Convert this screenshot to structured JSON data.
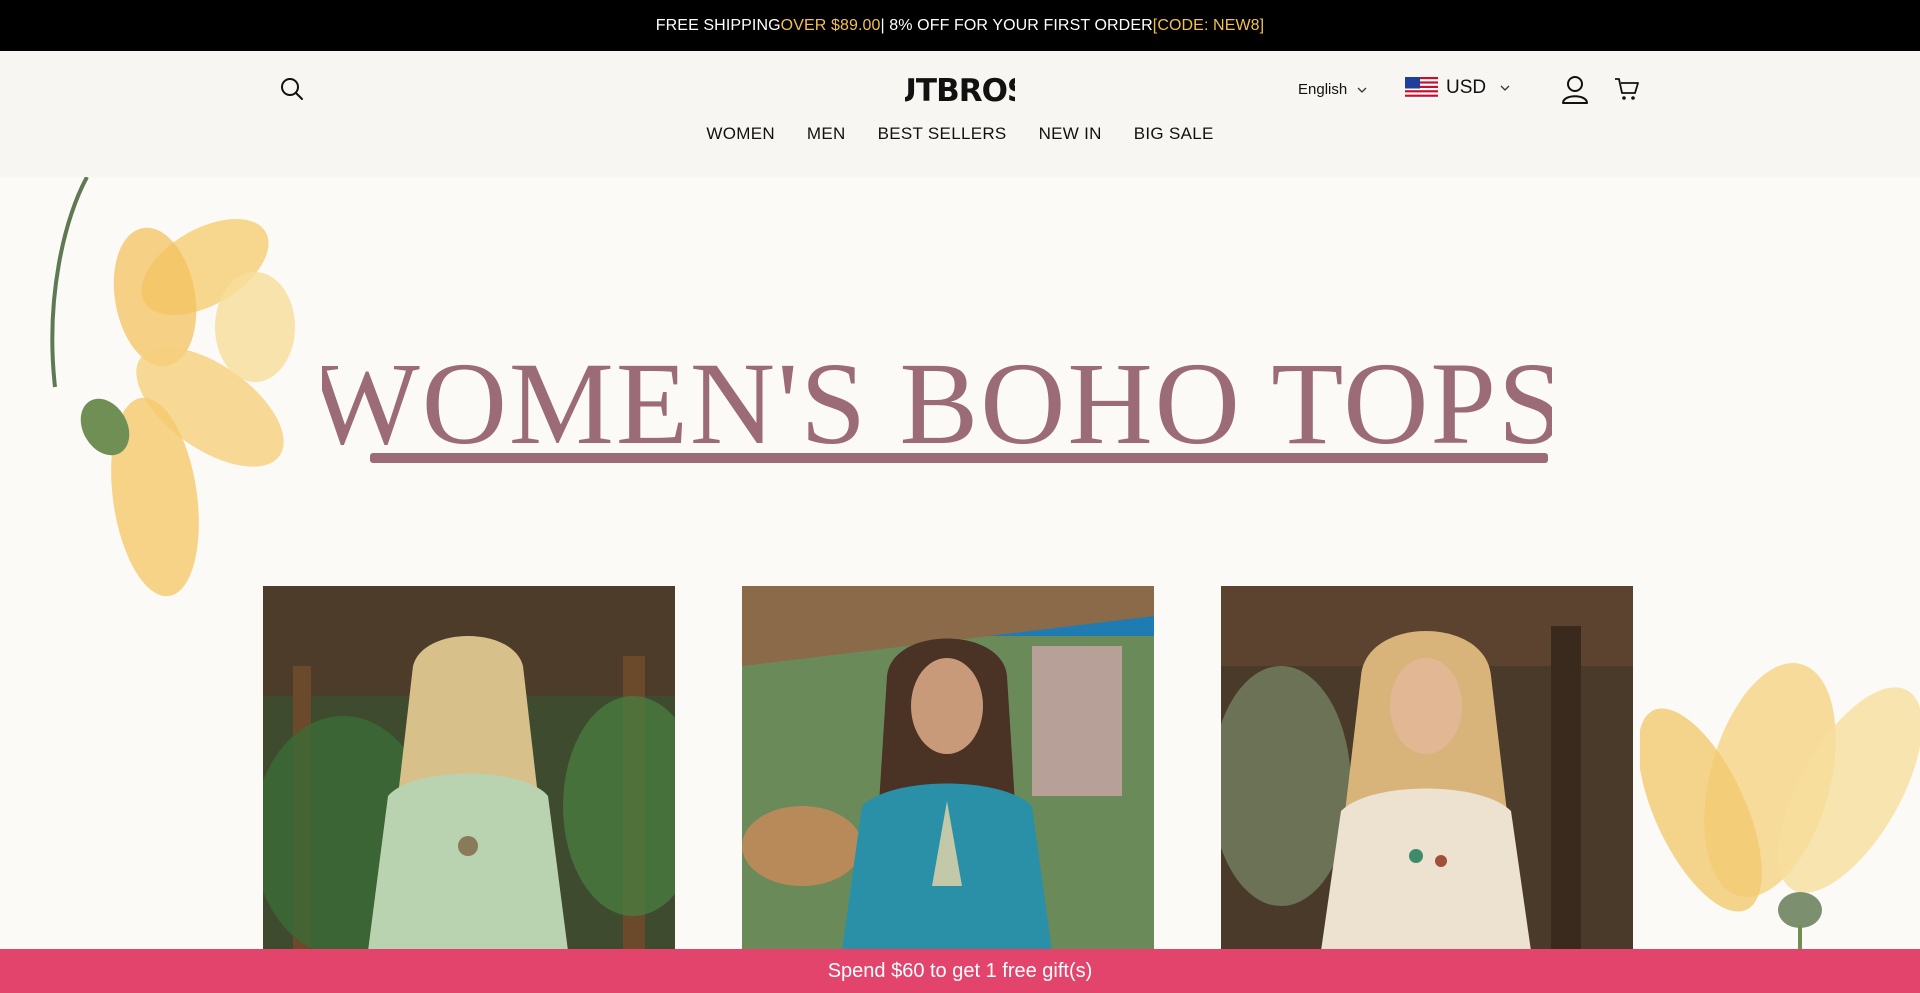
{
  "announcement": {
    "part1": "FREE SHIPPING ",
    "highlight1": "OVER $89.00",
    "part2": " | 8% OFF FOR YOUR FIRST ORDER ",
    "highlight2": "[CODE: NEW8]"
  },
  "header": {
    "logo_text": "UTBROS",
    "language": "English",
    "currency": "USD"
  },
  "nav": {
    "items": [
      "WOMEN",
      "MEN",
      "BEST SELLERS",
      "NEW IN",
      "BIG SALE"
    ]
  },
  "hero": {
    "title": "WOMEN'S BOHO TOPS"
  },
  "products": [
    {
      "image_alt": "Woman in green embroidered boho top"
    },
    {
      "image_alt": "Woman in teal embroidered boho top"
    },
    {
      "image_alt": "Woman in cream embroidered boho top"
    }
  ],
  "gift_bar": {
    "text": "Spend $60 to get 1 free gift(s)"
  },
  "colors": {
    "announce_bg": "#000000",
    "highlight": "#f2c14e",
    "title": "#9b6b78",
    "gift_bar": "#e2446b"
  }
}
